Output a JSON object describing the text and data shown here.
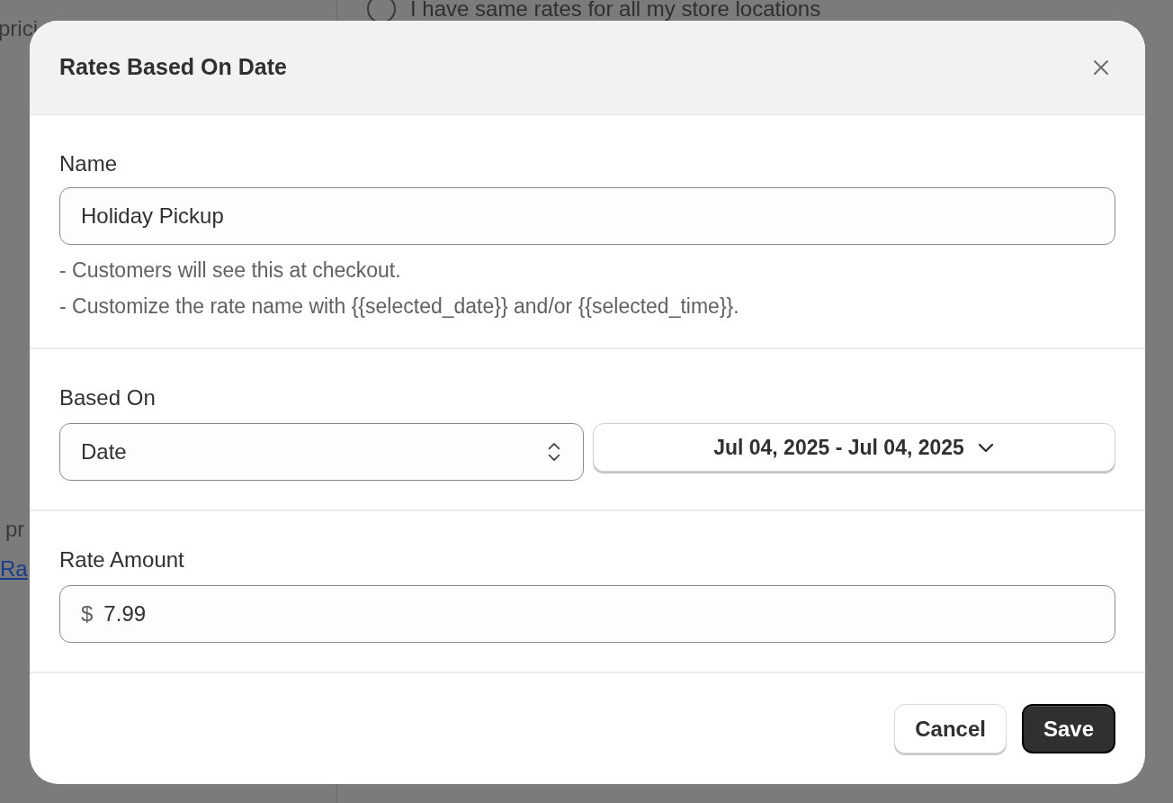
{
  "background": {
    "left_texts": [
      {
        "text": "prici",
        "kind": "text"
      },
      {
        "text": "pr",
        "kind": "text"
      },
      {
        "text": "Ra",
        "kind": "link"
      }
    ],
    "radio": {
      "label": "I have same rates for all my store locations",
      "selected": false
    }
  },
  "dialog": {
    "title": "Rates Based On Date",
    "name_field": {
      "label": "Name",
      "value": "Holiday Pickup",
      "help": [
        "- Customers will see this at checkout.",
        "- Customize the rate name with {{selected_date}} and/or {{selected_time}}."
      ]
    },
    "based_on": {
      "label": "Based On",
      "value": "Date",
      "date_range": "Jul 04, 2025 - Jul 04, 2025"
    },
    "rate_amount": {
      "label": "Rate Amount",
      "prefix": "$",
      "value": "7.99"
    },
    "buttons": [
      {
        "label": "Cancel",
        "kind": "secondary"
      },
      {
        "label": "Save",
        "kind": "primary"
      }
    ]
  }
}
